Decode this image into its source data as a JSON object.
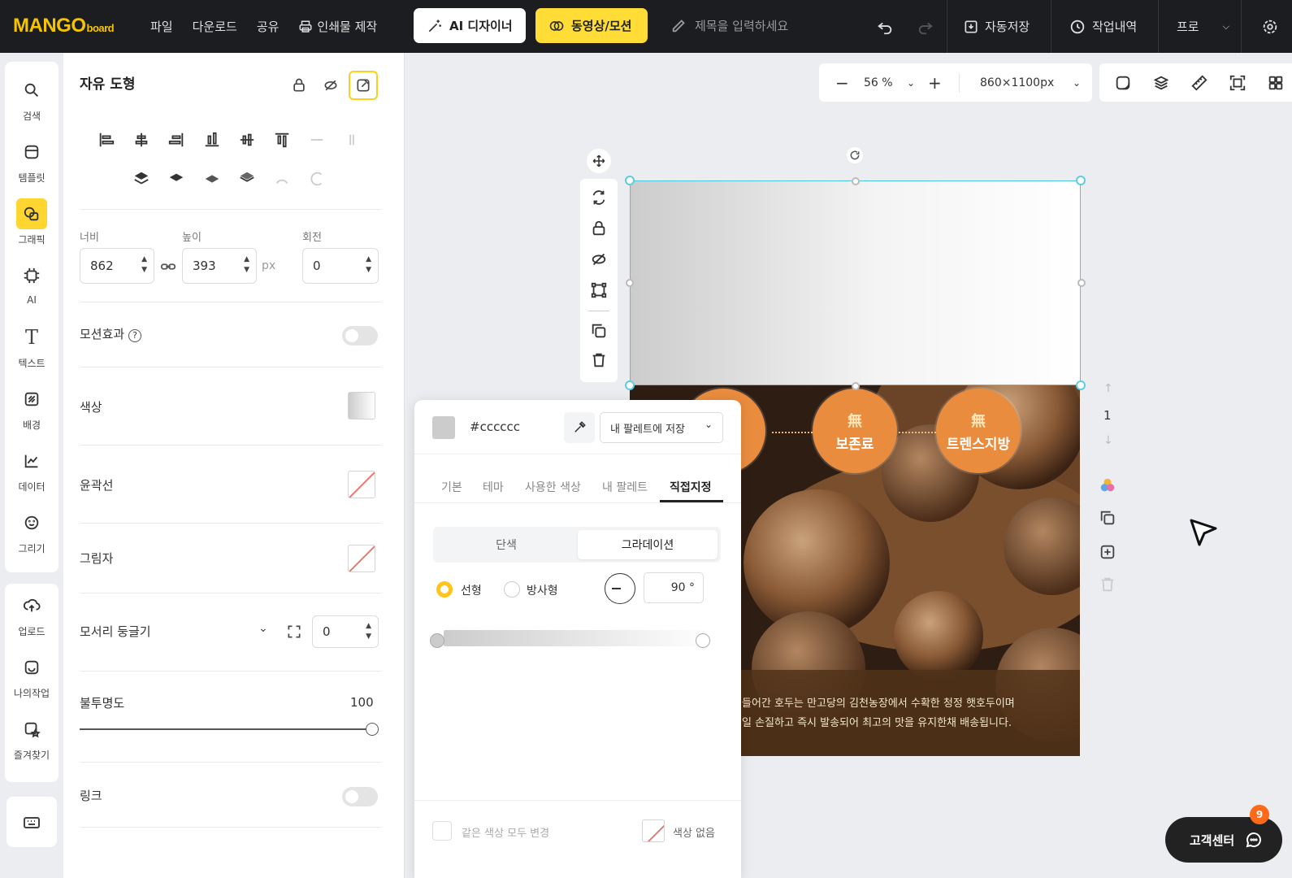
{
  "logo": {
    "main": "MANGO",
    "suffix": "board"
  },
  "menu": {
    "file": "파일",
    "download": "다운로드",
    "share": "공유",
    "print": "인쇄물 제작"
  },
  "buttons": {
    "ai_designer": "AI 디자이너",
    "video_motion": "동영상/모션"
  },
  "title_placeholder": "제목을 입력하세요",
  "topbar_right": {
    "autosave": "자동저장",
    "history": "작업내역",
    "plan": "프로"
  },
  "rail": {
    "items": [
      "검색",
      "템플릿",
      "그래픽",
      "AI",
      "텍스트",
      "배경",
      "데이터",
      "그리기"
    ],
    "items2": [
      "업로드",
      "나의작업",
      "즐겨찾기"
    ]
  },
  "props": {
    "title": "자유 도형",
    "width_label": "너비",
    "height_label": "높이",
    "rotate_label": "회전",
    "width": "862",
    "height": "393",
    "rotate": "0",
    "unit": "px",
    "motion": "모션효과",
    "color": "색상",
    "stroke": "윤곽선",
    "shadow": "그림자",
    "radius": "모서리 둥글기",
    "radius_value": "0",
    "opacity": "불투명도",
    "opacity_value": "100",
    "opacity_level": 1.0,
    "link": "링크"
  },
  "zoom": {
    "value": "56 %",
    "size": "860×1100px"
  },
  "artboard": {
    "badges": [
      {
        "k": "無",
        "t": "보존료"
      },
      {
        "k": "無",
        "t": "트렌스지방"
      }
    ],
    "desc_line1": "들어간 호두는 만고당의 김천농장에서 수확한 청정 햇호두이며",
    "desc_line2": "일 손질하고 즉시 발송되어 최고의 맛을 유지한채 배송됩니다."
  },
  "page_nav": {
    "page": "1"
  },
  "color_panel": {
    "hex": "#cccccc",
    "save_palette": "내 팔레트에 저장",
    "tabs": [
      "기본",
      "테마",
      "사용한 색상",
      "내 팔레트",
      "직접지정"
    ],
    "modes": [
      "단색",
      "그라데이션"
    ],
    "linear": "선형",
    "radial": "방사형",
    "angle": "90 °",
    "change_all": "같은 색상 모두 변경",
    "no_color": "색상 없음"
  },
  "support": {
    "label": "고객센터",
    "count": "9"
  },
  "colors": {
    "accent": "#ffd530",
    "selection": "#4ec5d8",
    "gradient_start": "#cccccc",
    "gradient_end": "#ffffff"
  }
}
